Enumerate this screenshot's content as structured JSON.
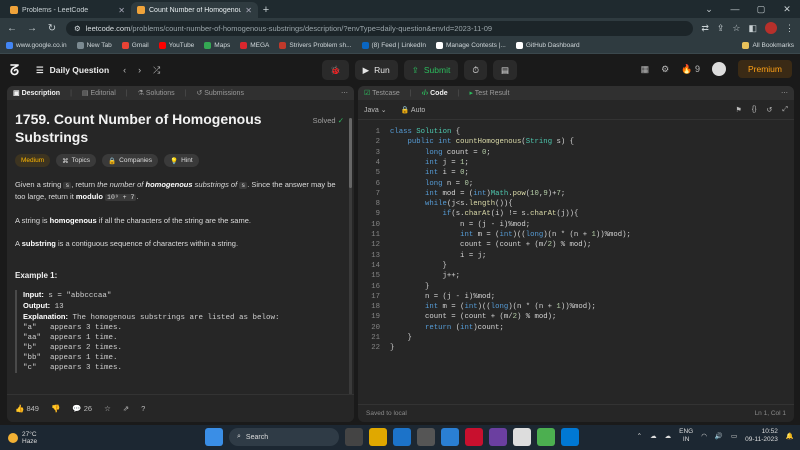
{
  "browser": {
    "tabs": [
      {
        "title": "Problems - LeetCode"
      },
      {
        "title": "Count Number of Homogenous"
      }
    ],
    "address": {
      "host": "leetcode.com",
      "path": "/problems/count-number-of-homogenous-substrings/description/?envType=daily-question&envId=2023-11-09"
    },
    "bookmarks": [
      {
        "label": "www.google.co.in",
        "color": "#4285f4"
      },
      {
        "label": "New Tab",
        "color": "#7b8a91"
      },
      {
        "label": "Gmail",
        "color": "#ea4335"
      },
      {
        "label": "YouTube",
        "color": "#ff0000"
      },
      {
        "label": "Maps",
        "color": "#34a853"
      },
      {
        "label": "MEGA",
        "color": "#d9272e"
      },
      {
        "label": "Strivers Problem sh...",
        "color": "#c0392b"
      },
      {
        "label": "(8) Feed | LinkedIn",
        "color": "#0a66c2"
      },
      {
        "label": "Manage Contests |...",
        "color": "#ffffff"
      },
      {
        "label": "GitHub Dashboard",
        "color": "#ffffff"
      }
    ],
    "all_bookmarks": "All Bookmarks"
  },
  "header": {
    "problem_list": "Daily Question",
    "run": "Run",
    "submit": "Submit",
    "streak": "9",
    "premium": "Premium"
  },
  "left": {
    "tabs": [
      "Description",
      "Editorial",
      "Solutions",
      "Submissions"
    ],
    "title": "1759. Count Number of Homogenous Substrings",
    "solved": "Solved",
    "chips": [
      "Medium",
      "Topics",
      "Companies",
      "Hint"
    ],
    "p1_a": "Given a string ",
    "p1_code1": "s",
    "p1_b": ", return ",
    "p1_c": "the number of ",
    "p1_d": "homogenous",
    "p1_e": " substrings of ",
    "p1_code2": "s",
    "p1_f": ". Since the answer may be too large, return it ",
    "p1_g": "modulo",
    "p1_code3": "10⁹ + 7",
    "p1_h": ".",
    "p2_a": "A string is ",
    "p2_b": "homogenous",
    "p2_c": " if all the characters of the string are the same.",
    "p3_a": "A ",
    "p3_b": "substring",
    "p3_c": " is a contiguous sequence of characters within a string.",
    "example_title": "Example 1:",
    "input_label": "Input:",
    "input_value": " s = \"abbcccaa\"",
    "output_label": "Output:",
    "output_value": " 13",
    "explanation_label": "Explanation:",
    "explanation_value": " The homogenous substrings are listed as below:",
    "lines": [
      "\"a\"   appears 3 times.",
      "\"aa\"  appears 1 time.",
      "\"b\"   appears 2 times.",
      "\"bb\"  appears 1 time.",
      "\"c\"   appears 3 times."
    ],
    "likes": "849",
    "comments": "26"
  },
  "right": {
    "tabs": [
      "Testcase",
      "Code",
      "Test Result"
    ],
    "language": "Java",
    "mode": "Auto",
    "code_lines": [
      "class Solution {",
      "    public int countHomogenous(String s) {",
      "        long count = 0;",
      "        int j = 1;",
      "        int i = 0;",
      "        long n = 0;",
      "        int mod = (int)Math.pow(10,9)+7;",
      "        while(j<s.length()){",
      "            if(s.charAt(i) != s.charAt(j)){",
      "                n = (j - i)%mod;",
      "                int m = (int)((long)(n * (n + 1))%mod);",
      "                count = (count + (m/2) % mod);",
      "                i = j;",
      "            }",
      "            j++;",
      "        }",
      "        n = (j - i)%mod;",
      "        int m = (int)((long)(n * (n + 1))%mod);",
      "        count = (count + (m/2) % mod);",
      "        return (int)count;",
      "    }",
      "}"
    ],
    "saved": "Saved to local",
    "cursor": "Ln 1, Col 1"
  },
  "taskbar": {
    "temp": "27°C",
    "weather": "Haze",
    "search": "Search",
    "lang1": "ENG",
    "lang2": "IN",
    "time": "10:52",
    "date": "09-11-2023"
  }
}
